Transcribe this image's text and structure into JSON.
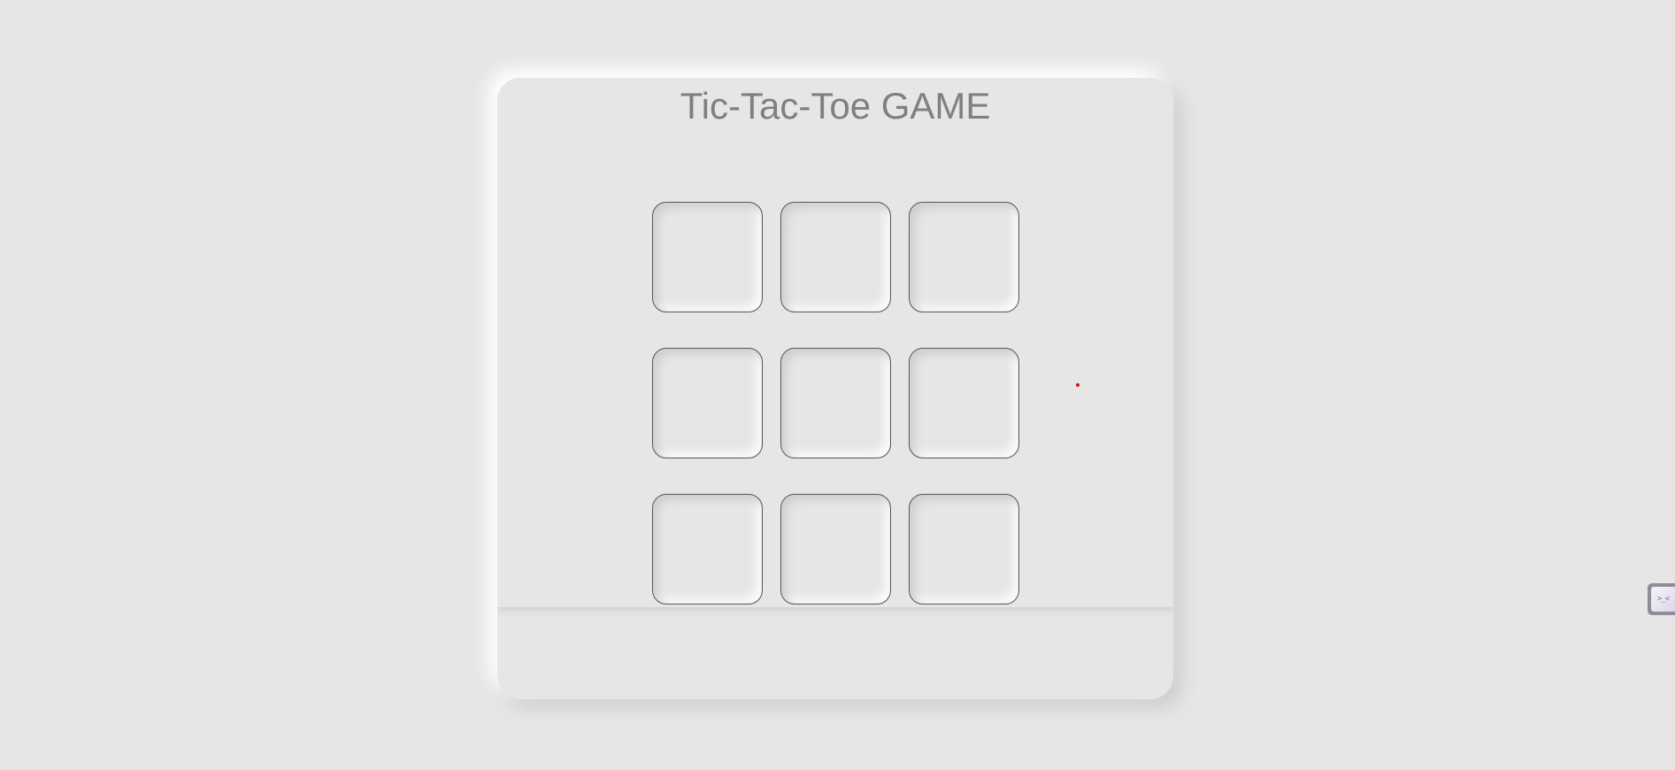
{
  "game": {
    "title": "Tic-Tac-Toe GAME",
    "board": [
      [
        "",
        "",
        ""
      ],
      [
        "",
        "",
        ""
      ],
      [
        "",
        "",
        ""
      ]
    ]
  },
  "widget": {
    "icon": "terminal-face-icon",
    "glyph": ">_<"
  },
  "colors": {
    "background": "#e6e6e6",
    "title": "#808080",
    "cell_border": "#555555",
    "cursor_dot": "#cc1111"
  }
}
